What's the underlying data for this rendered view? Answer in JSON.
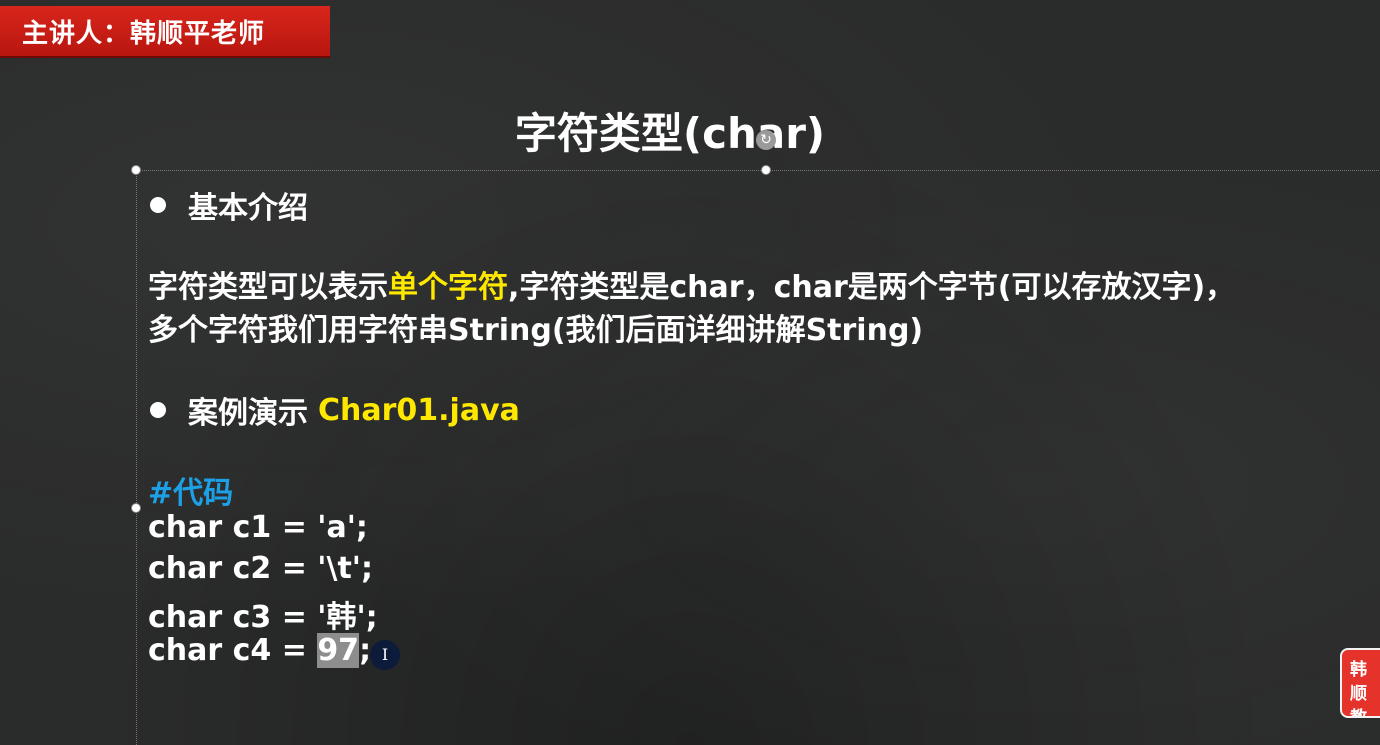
{
  "presenter": {
    "label": "主讲人：韩顺平老师"
  },
  "slide": {
    "title": "字符类型(char)",
    "section1": {
      "heading": "基本介绍",
      "para_line1_pre": "字符类型可以表示",
      "para_line1_highlight": "单个字符",
      "para_line1_post": ",字符类型是char，char是两个字节(可以存放汉字)，",
      "para_line2": "多个字符我们用字符串String(我们后面详细讲解String)"
    },
    "section2": {
      "heading_pre": "案例演示 ",
      "heading_file": "Char01.java"
    },
    "code": {
      "comment": "#代码",
      "line1": "char c1 = 'a';",
      "line2": "char c2 = '\\t';",
      "line3": "char c3 = '韩';",
      "line4_pre": "char c4 = ",
      "line4_selected": "97",
      "line4_post": ";"
    }
  },
  "overlay": {
    "rotate_glyph": "↻",
    "cursor_glyph": "I",
    "logo_text": "韩顺教"
  },
  "colors": {
    "background": "#2a2b2b",
    "badge": "#d8261c",
    "highlight": "#ffe800",
    "comment": "#1ea0e6"
  }
}
